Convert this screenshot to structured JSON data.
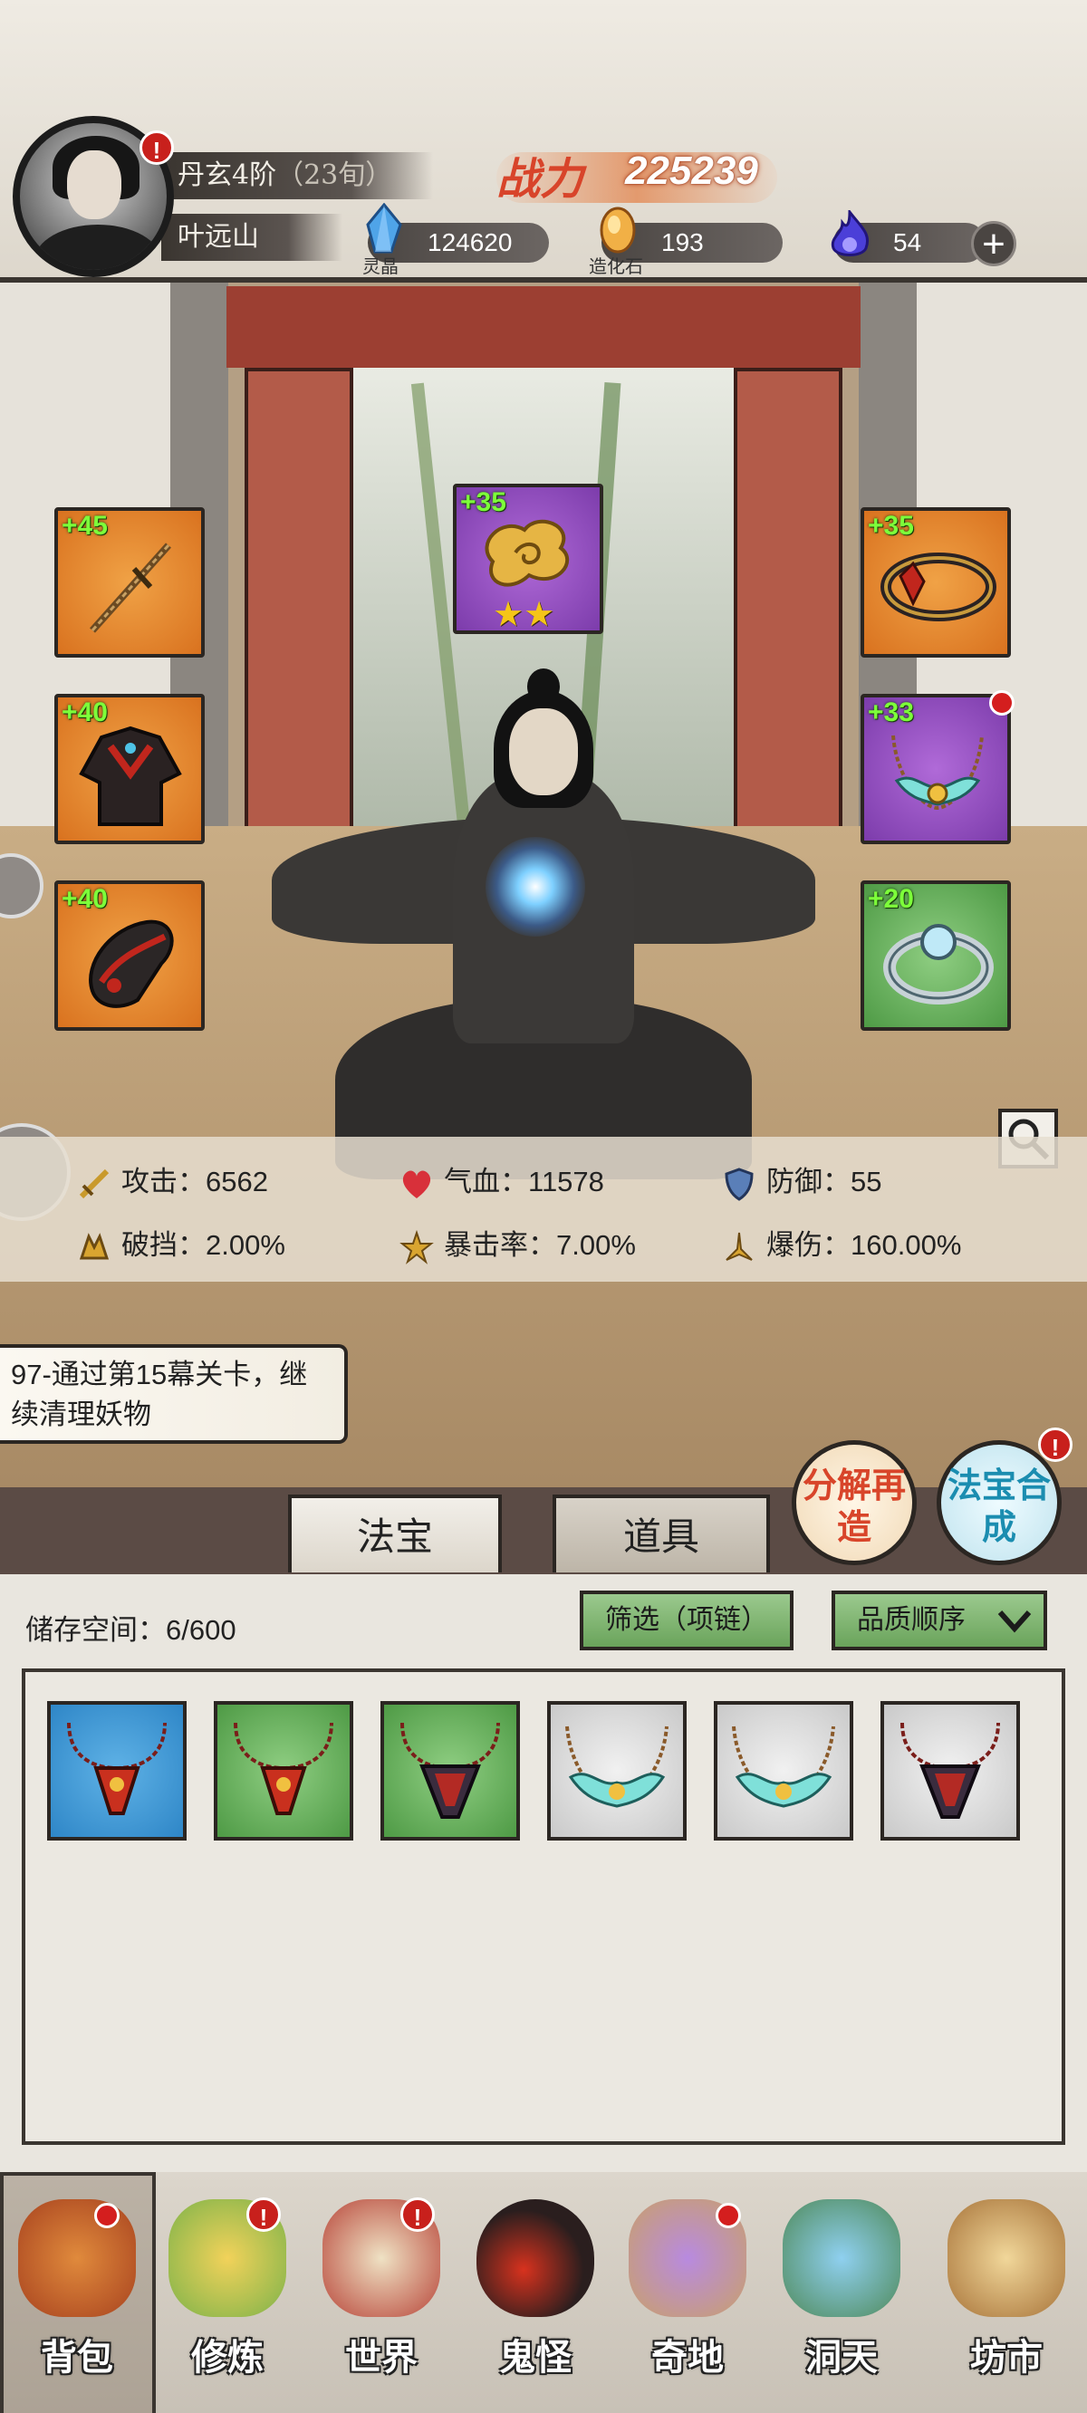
{
  "header": {
    "realm": "丹玄4阶",
    "age": "（23旬）",
    "player_name": "叶远山",
    "power_label": "战力",
    "power_value": "225239",
    "resources": [
      {
        "name": "灵晶",
        "value": "124620",
        "icon": "crystal-icon"
      },
      {
        "name": "造化石",
        "value": "193",
        "icon": "creation-stone-icon"
      },
      {
        "name": "",
        "value": "54",
        "icon": "blue-flame-icon"
      }
    ]
  },
  "equipment": {
    "top_center": {
      "bonus": "+35",
      "stars": 2,
      "icon": "golden-cloud-talisman-icon"
    },
    "left": [
      {
        "bonus": "+45",
        "icon": "sword-icon"
      },
      {
        "bonus": "+40",
        "icon": "robe-icon"
      },
      {
        "bonus": "+40",
        "icon": "boots-icon"
      }
    ],
    "right": [
      {
        "bonus": "+35",
        "icon": "headband-icon"
      },
      {
        "bonus": "+33",
        "icon": "necklace-icon"
      },
      {
        "bonus": "+20",
        "icon": "jade-ring-icon"
      }
    ]
  },
  "stats": {
    "attack": "攻击：6562",
    "hp": "气血：11578",
    "defense": "防御：55",
    "block_break": "破挡：2.00%",
    "crit_rate": "暴击率：7.00%",
    "crit_damage": "爆伤：160.00%"
  },
  "quest": {
    "text": "97-通过第15幕关卡，继续清理妖物"
  },
  "tabs": {
    "treasure": "法宝",
    "items": "道具"
  },
  "actions": {
    "decompose": "分解再造",
    "synthesize": "法宝合成"
  },
  "inventory": {
    "storage": "储存空间：6/600",
    "filter": "筛选（项链）",
    "sort": "品质顺序",
    "items": [
      {
        "rarity": "blue",
        "icon": "red-pendant-necklace-icon"
      },
      {
        "rarity": "green",
        "icon": "red-pendant-necklace-icon"
      },
      {
        "rarity": "green",
        "icon": "dark-pendant-necklace-icon"
      },
      {
        "rarity": "white",
        "icon": "jade-bird-necklace-icon"
      },
      {
        "rarity": "white",
        "icon": "jade-bird-necklace-icon"
      },
      {
        "rarity": "white",
        "icon": "dark-pendant-necklace-icon"
      }
    ]
  },
  "nav": [
    {
      "label": "背包",
      "icon": "backpack-icon",
      "alert": "dot"
    },
    {
      "label": "修炼",
      "icon": "cultivation-icon",
      "alert": "!"
    },
    {
      "label": "世界",
      "icon": "world-scroll-icon",
      "alert": "!"
    },
    {
      "label": "鬼怪",
      "icon": "demon-egg-icon",
      "alert": ""
    },
    {
      "label": "奇地",
      "icon": "mystic-land-icon",
      "alert": "dot"
    },
    {
      "label": "洞天",
      "icon": "cave-heaven-icon",
      "alert": ""
    },
    {
      "label": "坊市",
      "icon": "market-icon",
      "alert": ""
    }
  ]
}
